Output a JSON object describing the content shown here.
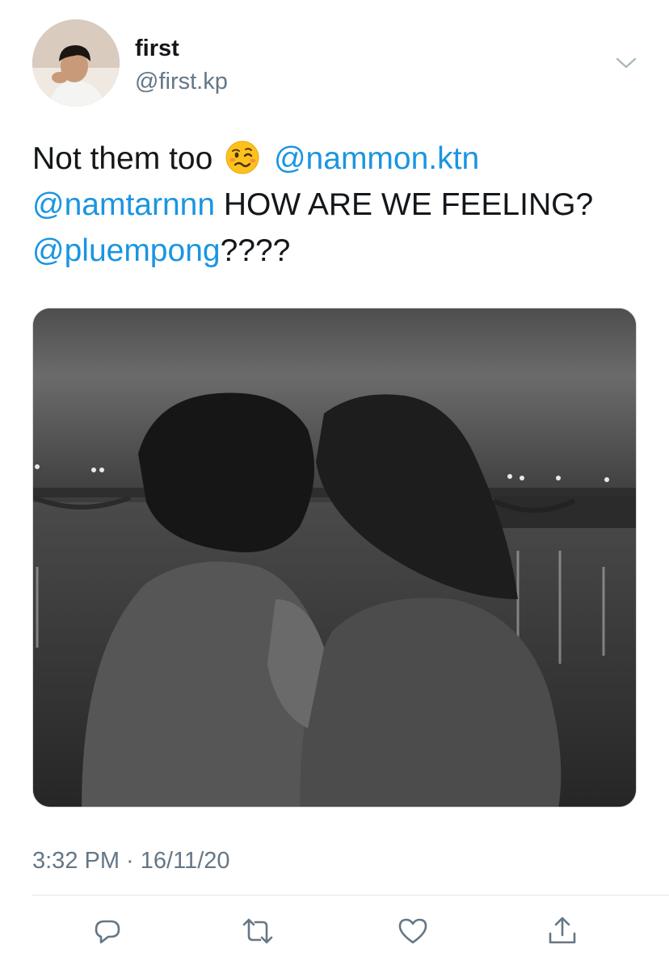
{
  "author": {
    "display_name": "first",
    "handle": "@first.kp"
  },
  "tweet": {
    "line1": {
      "text": "Not them too",
      "emoji": "woozy-face-emoji",
      "mention": "@nammon.ktn"
    },
    "line2": {
      "mention": "@namtarnnn",
      "text": "HOW ARE WE FEELING?"
    },
    "line3": {
      "mention": "@pluempong",
      "text": "????"
    }
  },
  "media": {
    "kind": "photo",
    "style": "black-and-white",
    "subject": "kissing-couple-at-riverside-night-photo"
  },
  "timestamp": "3:32 PM · 16/11/20",
  "actions": {
    "reply": "reply-icon",
    "retweet": "retweet-icon",
    "like": "heart-icon",
    "share": "share-icon"
  },
  "colors": {
    "mention": "#1b95e0",
    "secondary_text": "#657786",
    "primary_text": "#14171a",
    "divider": "#e1e8ed"
  }
}
